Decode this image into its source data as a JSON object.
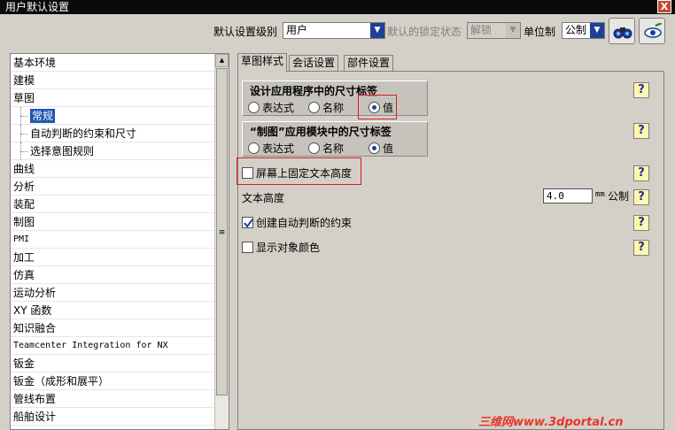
{
  "window": {
    "title": "用户默认设置",
    "close_label": "X"
  },
  "toolbar": {
    "level_label": "默认设置级别",
    "level_value": "用户",
    "lock_label": "默认的锁定状态",
    "lock_value": "解锁",
    "unit_label": "单位制",
    "unit_value": "公制"
  },
  "tree": {
    "items": [
      {
        "label": "基本环境"
      },
      {
        "label": "建模"
      },
      {
        "label": "草图"
      },
      {
        "label": "常规"
      },
      {
        "label": "自动判断的约束和尺寸"
      },
      {
        "label": "选择意图规则"
      },
      {
        "label": "曲线"
      },
      {
        "label": "分析"
      },
      {
        "label": "装配"
      },
      {
        "label": "制图"
      },
      {
        "label": "PMI"
      },
      {
        "label": "加工"
      },
      {
        "label": "仿真"
      },
      {
        "label": "运动分析"
      },
      {
        "label": "XY 函数"
      },
      {
        "label": "知识融合"
      },
      {
        "label": "Teamcenter Integration for NX"
      },
      {
        "label": "钣金"
      },
      {
        "label": "钣金（成形和展平）"
      },
      {
        "label": "管线布置"
      },
      {
        "label": "船舶设计"
      }
    ],
    "selected": "常规"
  },
  "tabs": [
    {
      "label": "草图样式"
    },
    {
      "label": "会话设置"
    },
    {
      "label": "部件设置"
    }
  ],
  "panel": {
    "group1": {
      "title": "设计应用程序中的尺寸标签",
      "options": [
        "表达式",
        "名称",
        "值"
      ],
      "selected": "值"
    },
    "group2": {
      "title": "“制图”应用模块中的尺寸标签",
      "options": [
        "表达式",
        "名称",
        "值"
      ],
      "selected": "值"
    },
    "fixed_text_height": {
      "label": "屏幕上固定文本高度",
      "checked": false
    },
    "text_height": {
      "label": "文本高度",
      "value": "4.0",
      "unit_prefix": "mm",
      "unit_suffix": "公制"
    },
    "create_inferred_constraints": {
      "label": "创建自动判断的约束",
      "checked": true
    },
    "show_object_color": {
      "label": "显示对象颜色",
      "checked": false
    },
    "help_glyph": "?"
  },
  "watermark": "三维网www.3dportal.cn",
  "colors": {
    "selection": "#1f56b0",
    "highlight_box": "#d42020",
    "help_bg": "#fff7b0"
  }
}
